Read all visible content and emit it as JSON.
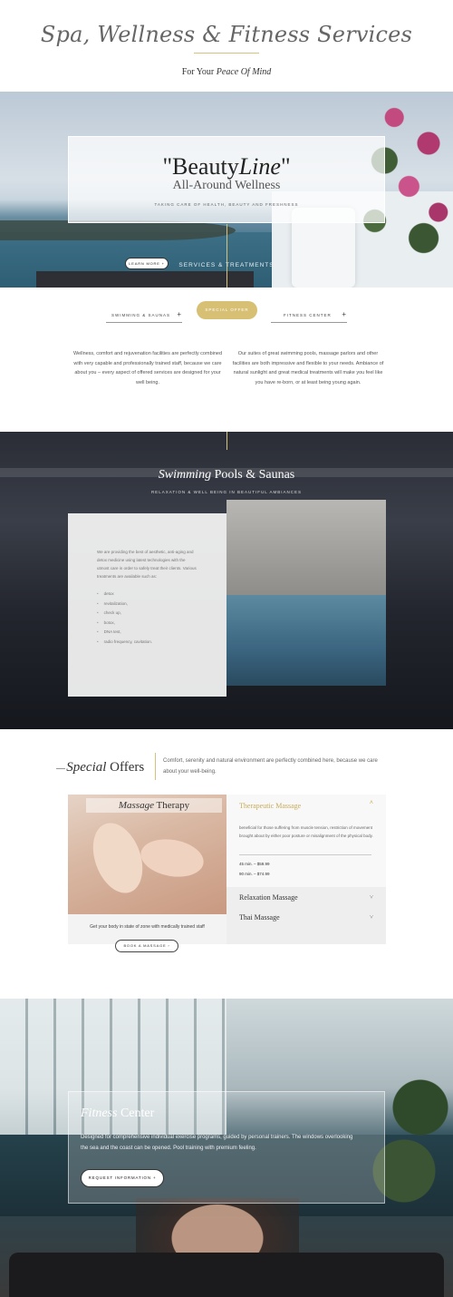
{
  "header": {
    "title": "Spa, Wellness & Fitness Services",
    "tagline_prefix": "For Your ",
    "tagline_emphasis": "Peace Of Mind"
  },
  "hero": {
    "brand_regular": "\"Beauty",
    "brand_italic": "Line",
    "brand_close": "\"",
    "subtitle": "All-Around Wellness",
    "caption": "TAKING CARE OF HEALTH, BEAUTY AND FRESHNESS",
    "section_label": "SERVICES & TREATMENTS"
  },
  "tabs": [
    {
      "label": "SWIMMING & SAUNAS",
      "icon": "plus-icon"
    },
    {
      "label": "SPECIAL OFFER",
      "icon": "plus-icon"
    },
    {
      "label": "FITNESS CENTER",
      "icon": "plus-icon"
    }
  ],
  "intro": {
    "left": "Wellness, comfort and rejuvenation facilities  are perfectly combined with very capable and professionally trained staff, because we care about you – every aspect of offered services are designed for your well being.",
    "right": "Our suites of great swimming pools, massage parlors and other facilities  are both impressive and flexible to your needs. Ambiance of natural sunlight and great medical treatments will make you feel like you have re-born, or at least being young again."
  },
  "pools": {
    "title_italic": "Swimming",
    "title_rest": " Pools & Saunas",
    "subtitle": "RELAXATION & WELL BEING IN BEAUTIFUL AMBIANCES",
    "text": "We are providing the best of aesthetic, anti-aging and detox medicine using latest technologies with the utmost care in order to safely treat their clients. Various treatments are available such as:",
    "treatments": [
      "detox",
      "revitalization,",
      "check up,",
      "botox,",
      "DNA test,",
      "radio frequency, cavitation."
    ],
    "button": "LEARN MORE",
    "button_icon": "plus-icon"
  },
  "offers": {
    "title_italic": "Special",
    "title_rest": " Offers",
    "description": "Comfort, serenity and natural environment are perfectly combined here, because we care about your well-being.",
    "massage_italic": "Massage",
    "massage_rest": " Therapy",
    "massage_caption": "Get your body in state of zone with medically trained staff",
    "book_button": "BOOK A MASSAGE",
    "book_icon": "chevron-right-icon",
    "accordion": {
      "open_title": "Therapeutic Massage",
      "open_text": "beneficial for those suffering from muscle tension, restriction of movement brought about by either poor posture or misalignment of the physical body.",
      "price_45": "45 min. – $59.99",
      "price_90": "90 min. – $74.99",
      "items": [
        "Relaxation Massage",
        "Thai Massage"
      ]
    }
  },
  "fitness": {
    "title_italic": "Fitness",
    "title_rest": " Center",
    "text": "Designed for comprehensive individual exercise programs, guided by personal trainers. The windows overlooking the sea and the coast can be opened. Pool training with premium feeling.",
    "button": "REQUEST INFORMATION",
    "button_icon": "plus-icon"
  },
  "colors": {
    "accent_gold": "#d7c074",
    "text_dark": "#333333"
  }
}
